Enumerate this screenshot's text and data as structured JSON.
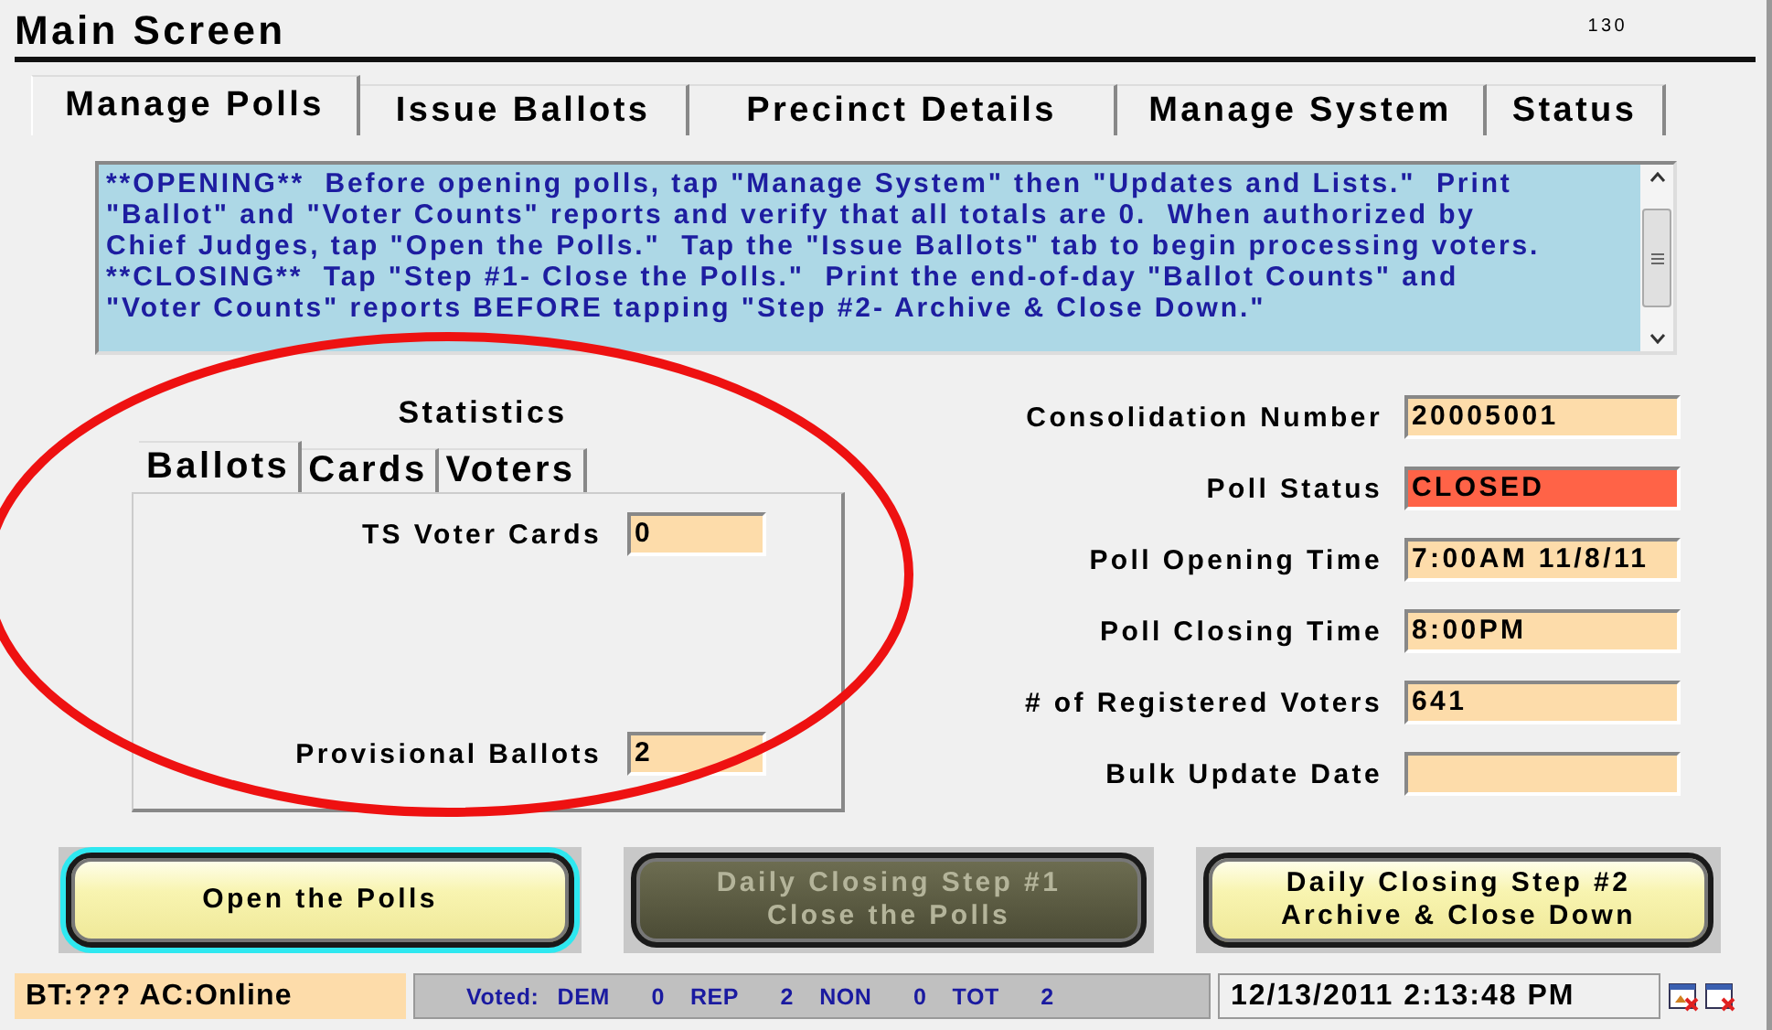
{
  "window": {
    "title": "Main Screen",
    "code": "130"
  },
  "tabs": [
    {
      "label": "Manage Polls",
      "selected": true
    },
    {
      "label": "Issue Ballots",
      "selected": false
    },
    {
      "label": "Precinct Details",
      "selected": false
    },
    {
      "label": "Manage System",
      "selected": false
    },
    {
      "label": "Status",
      "selected": false
    }
  ],
  "instructions": "**OPENING**  Before opening polls, tap \"Manage System\" then \"Updates and Lists.\"  Print\n\"Ballot\" and \"Voter Counts\" reports and verify that all totals are 0.  When authorized by\nChief Judges, tap \"Open the Polls.\"  Tap the \"Issue Ballots\" tab to begin processing voters.\n**CLOSING**  Tap \"Step #1- Close the Polls.\"  Print the end-of-day \"Ballot Counts\" and\n\"Voter Counts\" reports BEFORE tapping \"Step #2- Archive & Close Down.\"",
  "statistics": {
    "title": "Statistics",
    "tabs": [
      {
        "label": "Ballots",
        "selected": true
      },
      {
        "label": "Cards",
        "selected": false
      },
      {
        "label": "Voters",
        "selected": false
      }
    ],
    "fields": [
      {
        "label": "TS Voter Cards",
        "value": "0"
      },
      {
        "label": "Provisional Ballots",
        "value": "2"
      }
    ]
  },
  "details": [
    {
      "label": "Consolidation Number",
      "value": "20005001",
      "alert": false
    },
    {
      "label": "Poll Status",
      "value": "CLOSED",
      "alert": true
    },
    {
      "label": "Poll Opening Time",
      "value": "7:00AM 11/8/11",
      "alert": false
    },
    {
      "label": "Poll Closing Time",
      "value": "8:00PM",
      "alert": false
    },
    {
      "label": "# of Registered Voters",
      "value": "641",
      "alert": false
    },
    {
      "label": "Bulk Update Date",
      "alert": false
    }
  ],
  "buttons": [
    {
      "label": "Open the Polls",
      "focused": true,
      "disabled": false
    },
    {
      "label": "Daily Closing Step #1\nClose the Polls",
      "focused": false,
      "disabled": true
    },
    {
      "label": "Daily Closing Step #2\nArchive & Close Down",
      "focused": false,
      "disabled": false
    }
  ],
  "status_bar": {
    "connection": "BT:??? AC:Online",
    "voted_label": "Voted:",
    "counts": [
      {
        "party": "DEM",
        "count": "0"
      },
      {
        "party": "REP",
        "count": "2"
      },
      {
        "party": "NON",
        "count": "0"
      },
      {
        "party": "TOT",
        "count": "2"
      }
    ],
    "datetime": "12/13/2011 2:13:48 PM"
  },
  "annotation": {
    "kind": "ellipse"
  }
}
